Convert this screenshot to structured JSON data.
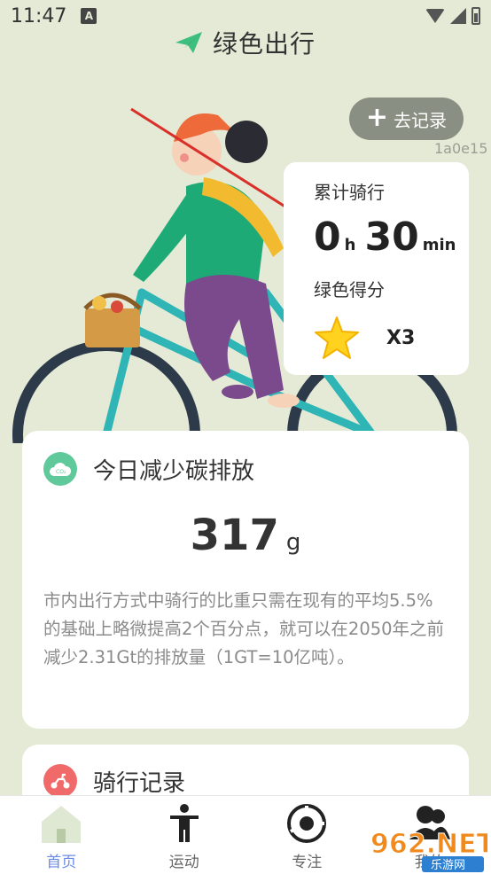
{
  "status_bar": {
    "time": "11:47",
    "indicator": "A"
  },
  "app": {
    "title": "绿色出行"
  },
  "hero": {
    "record_button_label": "去记录",
    "id_tag": "1a0e15",
    "ride_card": {
      "ride_label": "累计骑行",
      "hours": "0",
      "hours_unit": "h",
      "minutes": "30",
      "minutes_unit": "min",
      "score_label": "绿色得分",
      "score_multiplier": "X3"
    }
  },
  "carbon": {
    "title": "今日减少碳排放",
    "value": "317",
    "unit": "g",
    "icon_text": "CO₂",
    "description": "市内出行方式中骑行的比重只需在现有的平均5.5%的基础上略微提高2个百分点，就可以在2050年之前减少2.31Gt的排放量（1GT=10亿吨）。"
  },
  "history": {
    "title": "骑行记录"
  },
  "nav": {
    "items": [
      {
        "label": "首页",
        "icon": "home-icon",
        "active": true
      },
      {
        "label": "运动",
        "icon": "person-icon",
        "active": false
      },
      {
        "label": "专注",
        "icon": "focus-icon",
        "active": false
      },
      {
        "label": "我的",
        "icon": "profile-icon",
        "active": false
      }
    ]
  },
  "watermark": {
    "text": "962.NET",
    "subtext": "乐游网"
  },
  "colors": {
    "background": "#e4ead6",
    "accent_green": "#5fc99b",
    "accent_red": "#f06a6a",
    "nav_active": "#6a8be6"
  }
}
